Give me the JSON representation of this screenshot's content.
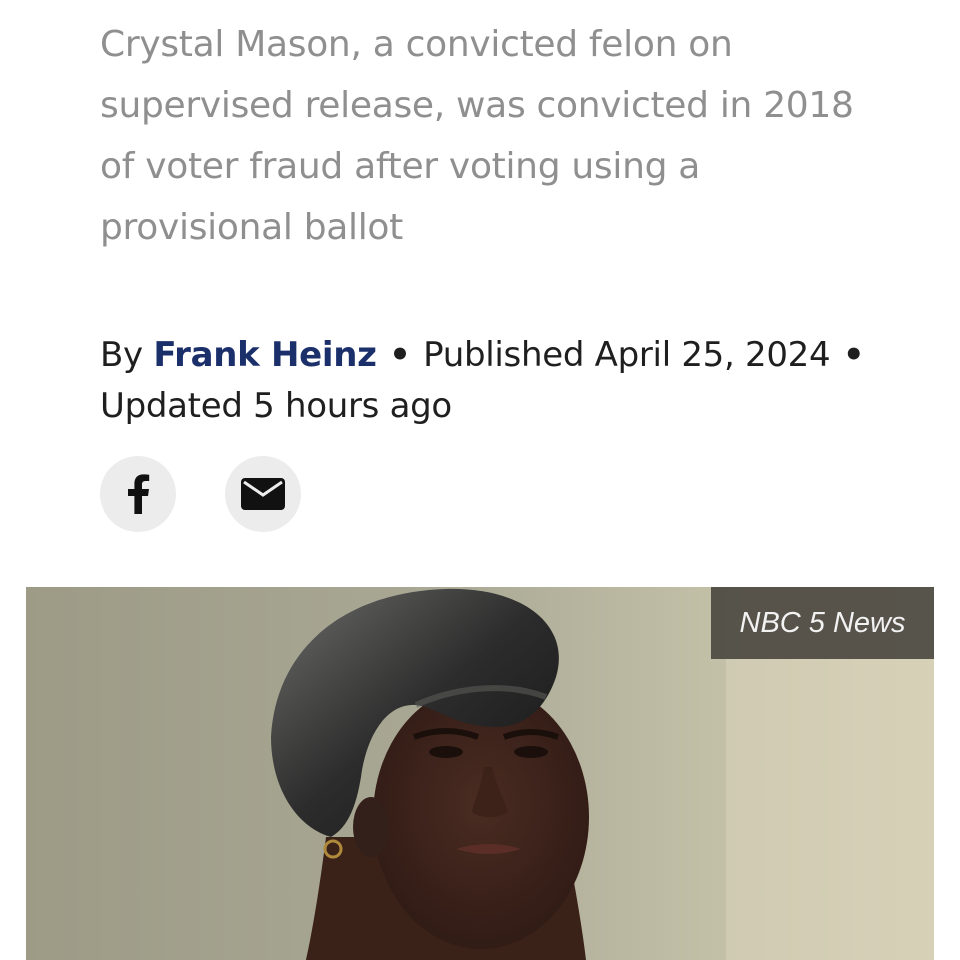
{
  "article": {
    "dek": "Crystal Mason, a convicted felon on supervised release, was convicted in 2018 of voter fraud after voting using a provisional ballot",
    "byline": {
      "by_label": "By",
      "author": "Frank Heinz",
      "separator": "•",
      "published": "Published April 25, 2024",
      "updated": "Updated 5 hours ago"
    },
    "share": {
      "facebook_icon": "facebook-icon",
      "email_icon": "envelope-icon"
    },
    "hero_image": {
      "credit": "NBC 5 News"
    }
  },
  "colors": {
    "dek_text": "#8f8f8f",
    "byline_text": "#1f1f1f",
    "author_link": "#1b2f6b",
    "share_button_bg": "#ececec"
  }
}
